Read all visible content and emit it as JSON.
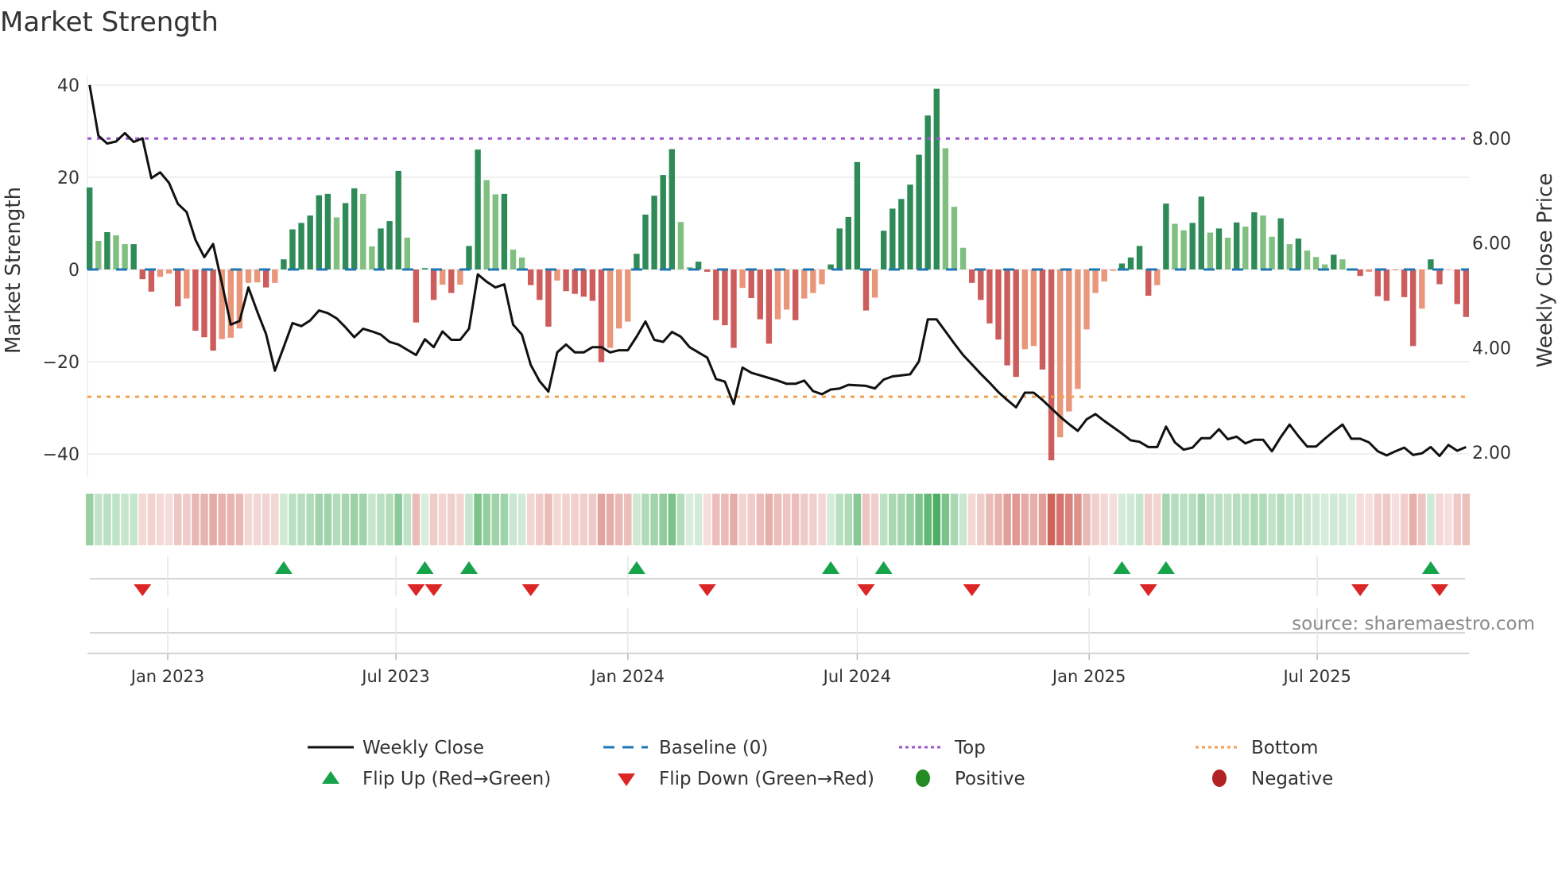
{
  "title": "Market Strength",
  "source": "source: sharemaestro.com",
  "chart_data": {
    "type": "bar+line",
    "title": "Market Strength",
    "frequency": "weekly",
    "start_date": "2022-10-31",
    "strength": [
      17.8,
      6.2,
      8.1,
      7.4,
      5.5,
      5.5,
      -2.1,
      -4.8,
      -1.6,
      -0.9,
      -8.0,
      -6.3,
      -13.3,
      -14.7,
      -17.6,
      -15.1,
      -14.8,
      -12.8,
      -2.9,
      -2.8,
      -3.9,
      -2.9,
      2.2,
      8.7,
      10.1,
      11.7,
      16.1,
      16.4,
      11.3,
      14.4,
      17.6,
      16.4,
      5.0,
      8.9,
      10.5,
      21.4,
      6.9,
      -11.5,
      0.3,
      -6.6,
      -3.3,
      -5.1,
      -3.3,
      5.1,
      26.0,
      19.4,
      16.3,
      16.4,
      4.3,
      2.6,
      -3.4,
      -6.6,
      -12.4,
      -2.4,
      -4.7,
      -5.3,
      -5.9,
      -6.8,
      -20.1,
      -17.0,
      -12.8,
      -11.3,
      3.4,
      11.9,
      16.0,
      20.5,
      26.1,
      10.3,
      0.5,
      1.7,
      -0.5,
      -11.0,
      -12.1,
      -17.0,
      -4.0,
      -6.2,
      -10.8,
      -16.1,
      -10.8,
      -8.7,
      -11.0,
      -6.3,
      -5.1,
      -3.2,
      1.1,
      8.9,
      11.4,
      23.3,
      -8.9,
      -6.1,
      8.4,
      13.2,
      15.3,
      18.4,
      24.9,
      33.4,
      39.2,
      26.3,
      13.6,
      4.7,
      -2.9,
      -6.6,
      -11.7,
      -15.2,
      -20.8,
      -23.3,
      -17.3,
      -16.6,
      -21.7,
      -41.4,
      -36.4,
      -30.8,
      -25.9,
      -13.0,
      -5.1,
      -2.6,
      -0.3,
      1.3,
      2.6,
      5.1,
      -5.7,
      -3.4,
      14.3,
      9.9,
      8.5,
      10.1,
      15.8,
      8.0,
      8.9,
      6.9,
      10.2,
      9.3,
      12.4,
      11.7,
      7.1,
      11.1,
      5.5,
      6.7,
      4.1,
      2.7,
      1.1,
      3.2,
      2.2,
      0.1,
      -1.4,
      -0.5,
      -5.8,
      -6.8,
      -0.2,
      -6.0,
      -16.6,
      -8.5,
      2.2,
      -3.2,
      -0.1,
      -7.5,
      -10.3
    ],
    "close": [
      9.02,
      8.05,
      7.9,
      7.94,
      8.1,
      7.93,
      8.0,
      7.24,
      7.35,
      7.15,
      6.75,
      6.59,
      6.06,
      5.73,
      5.98,
      5.23,
      4.44,
      4.51,
      5.15,
      4.69,
      4.26,
      3.56,
      4.01,
      4.47,
      4.41,
      4.52,
      4.71,
      4.66,
      4.56,
      4.39,
      4.2,
      4.36,
      4.31,
      4.25,
      4.11,
      4.06,
      3.96,
      3.86,
      4.16,
      4.01,
      4.31,
      4.15,
      4.15,
      4.36,
      5.4,
      5.26,
      5.15,
      5.21,
      4.44,
      4.25,
      3.67,
      3.36,
      3.16,
      3.91,
      4.06,
      3.91,
      3.91,
      4.01,
      4.01,
      3.91,
      3.95,
      3.95,
      4.21,
      4.5,
      4.15,
      4.11,
      4.3,
      4.21,
      4.01,
      3.91,
      3.81,
      3.4,
      3.35,
      2.92,
      3.62,
      3.52,
      3.47,
      3.42,
      3.37,
      3.31,
      3.31,
      3.37,
      3.17,
      3.11,
      3.2,
      3.22,
      3.29,
      3.28,
      3.27,
      3.22,
      3.39,
      3.45,
      3.47,
      3.49,
      3.74,
      4.54,
      4.54,
      4.31,
      4.08,
      3.86,
      3.68,
      3.5,
      3.33,
      3.15,
      3.0,
      2.86,
      3.14,
      3.14,
      3.0,
      2.84,
      2.68,
      2.54,
      2.41,
      2.63,
      2.73,
      2.6,
      2.48,
      2.36,
      2.23,
      2.2,
      2.1,
      2.1,
      2.49,
      2.19,
      2.05,
      2.09,
      2.27,
      2.27,
      2.44,
      2.25,
      2.3,
      2.17,
      2.24,
      2.24,
      2.02,
      2.29,
      2.53,
      2.31,
      2.11,
      2.11,
      2.26,
      2.4,
      2.53,
      2.26,
      2.26,
      2.19,
      2.02,
      1.94,
      2.02,
      2.09,
      1.95,
      1.98,
      2.1,
      1.93,
      2.14,
      2.03,
      2.1
    ],
    "top": 28.4,
    "bottom": -27.6,
    "baseline": 0,
    "left_axis": {
      "label": "Market Strength",
      "ticks": [
        40,
        20,
        0,
        -20,
        -40
      ],
      "tick_labels": [
        "40",
        "20",
        "0",
        "−20",
        "−40"
      ],
      "range": [
        -45,
        42
      ]
    },
    "right_axis": {
      "label": "Weekly Close Price",
      "ticks": [
        8,
        6,
        4,
        2
      ],
      "tick_labels": [
        "8.00",
        "6.00",
        "4.00",
        "2.00"
      ]
    },
    "x_ticks": [
      {
        "label": "Jan 2023",
        "date": "2023-01-01"
      },
      {
        "label": "Jul 2023",
        "date": "2023-07-01"
      },
      {
        "label": "Jan 2024",
        "date": "2024-01-01"
      },
      {
        "label": "Jul 2024",
        "date": "2024-07-01"
      },
      {
        "label": "Jan 2025",
        "date": "2025-01-01"
      },
      {
        "label": "Jul 2025",
        "date": "2025-07-01"
      }
    ],
    "legend": {
      "weekly_close": "Weekly Close",
      "baseline": "Baseline (0)",
      "top": "Top",
      "bottom": "Bottom",
      "flip_up": "Flip Up (Red→Green)",
      "flip_down": "Flip Down (Green→Red)",
      "positive": "Positive",
      "negative": "Negative"
    },
    "legend_placement": "bottom",
    "colors": {
      "pos_strong": "#2e8b57",
      "pos_weak": "#80bf80",
      "neg_strong": "#cd5c5c",
      "neg_weak": "#e9967a",
      "close": "#111111",
      "baseline": "#1f77b4",
      "top": "#9b59d0",
      "bottom": "#f0a050",
      "flip_up": "#16a34a",
      "flip_down": "#dc2626",
      "positive": "#228b22",
      "negative": "#b22222"
    }
  }
}
